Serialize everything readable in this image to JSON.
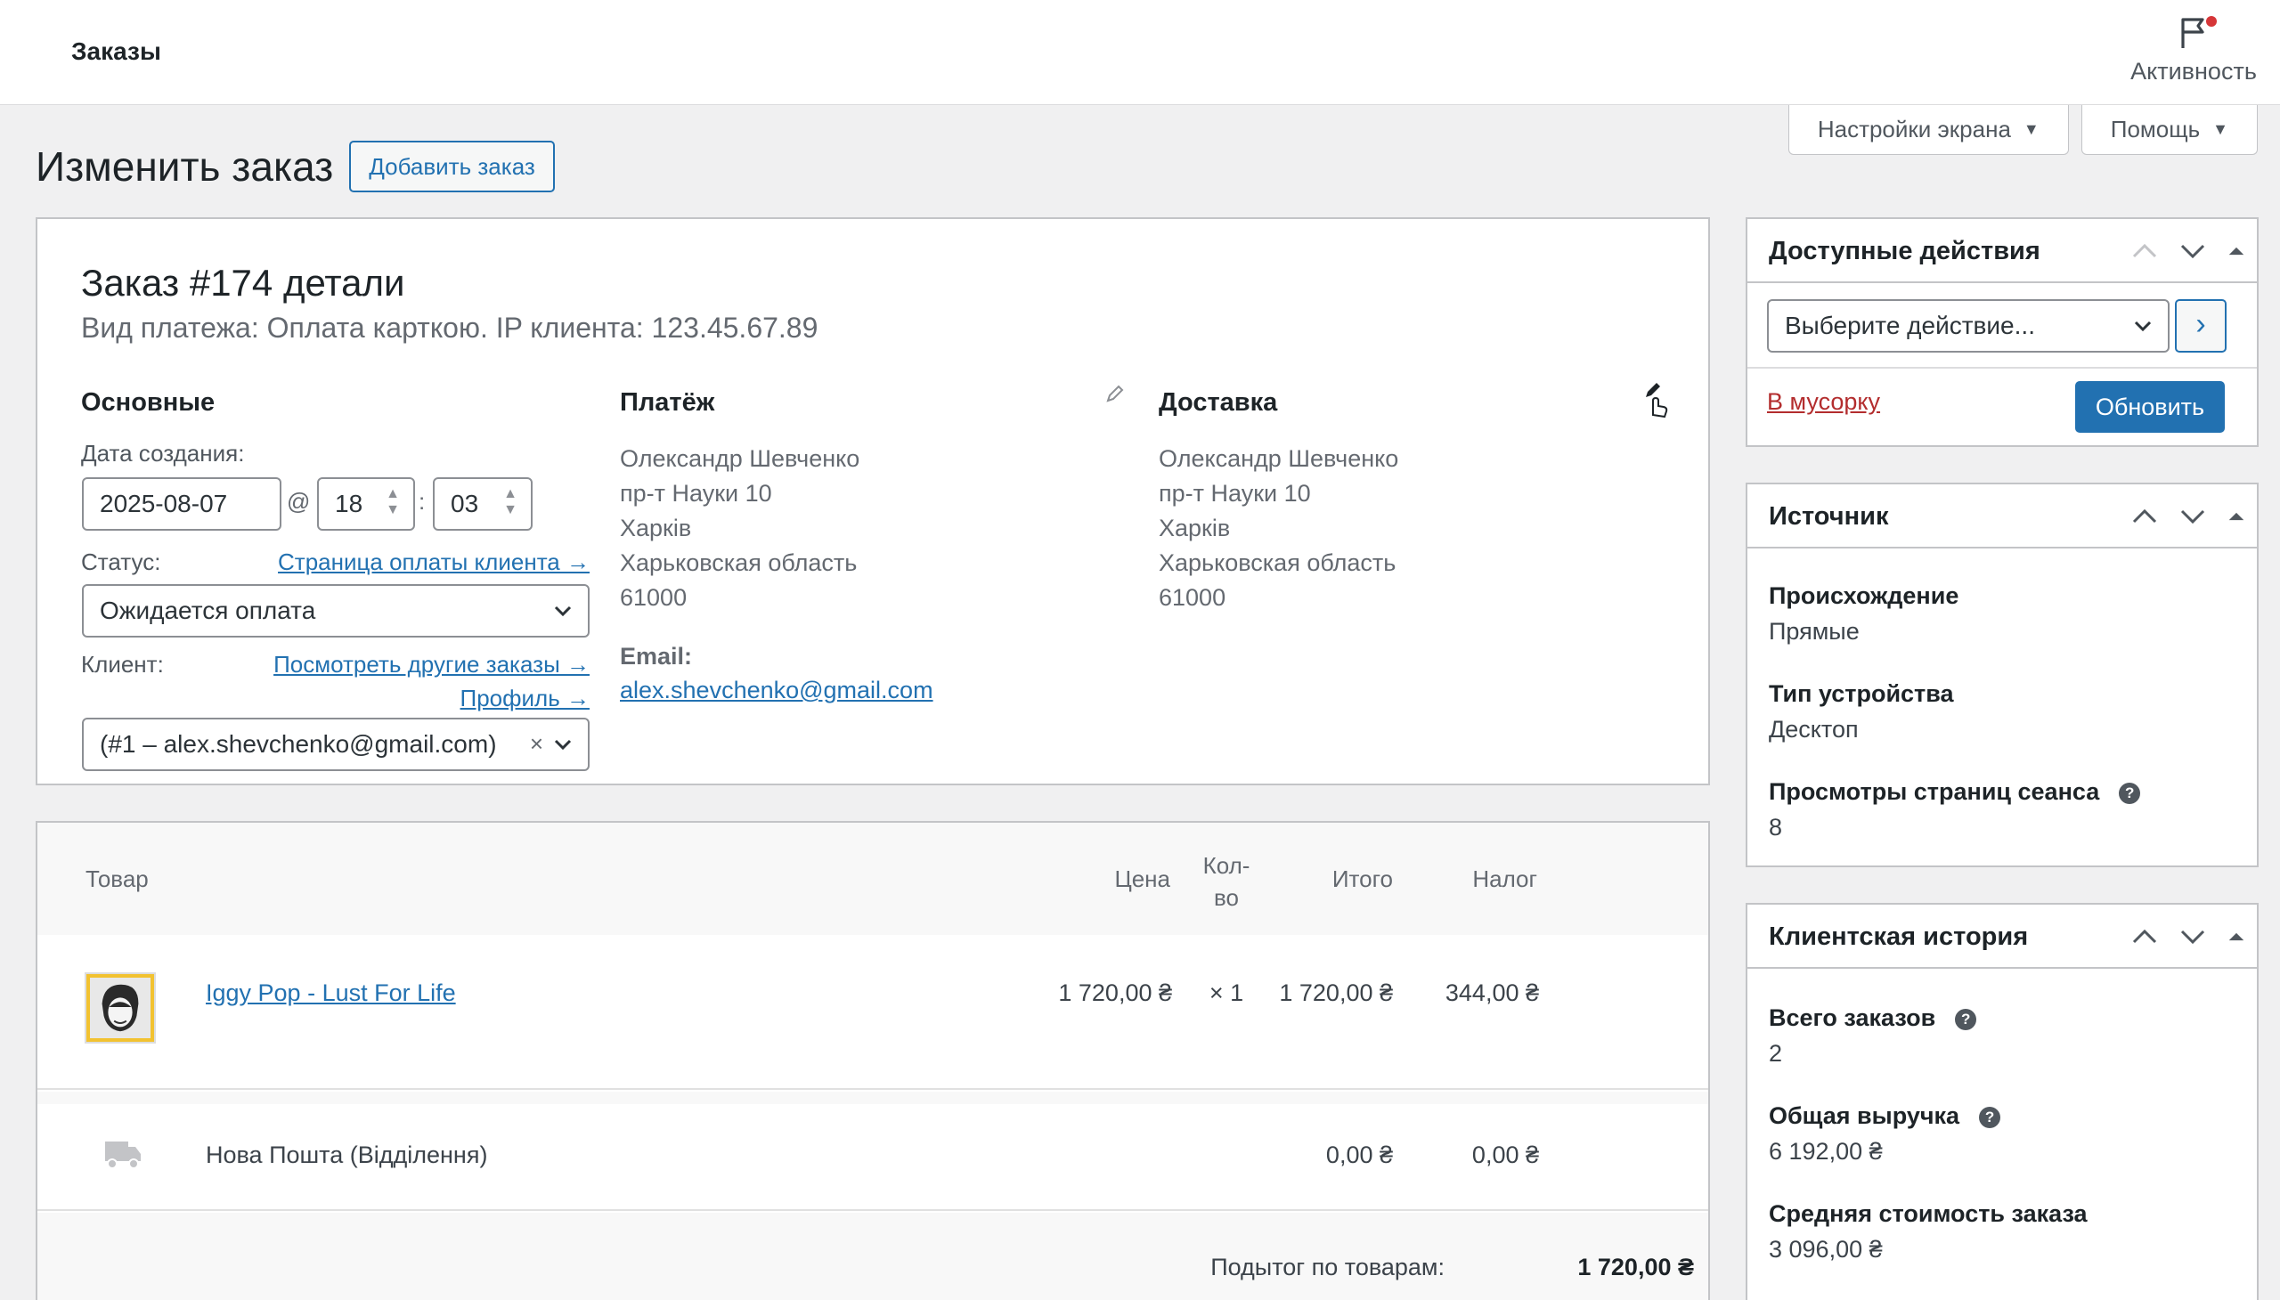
{
  "topbar": {
    "title": "Заказы",
    "activity_label": "Активность"
  },
  "screen_tabs": {
    "screen_options": "Настройки экрана",
    "help": "Помощь"
  },
  "page": {
    "heading": "Изменить заказ",
    "add_order": "Добавить заказ"
  },
  "order": {
    "title": "Заказ #174 детали",
    "subtitle": "Вид платежа: Оплата карткою. IP клиента: 123.45.67.89",
    "general": {
      "heading": "Основные",
      "date_label": "Дата создания:",
      "date": "2025-08-07",
      "at": "@",
      "hour": "18",
      "colon": ":",
      "minute": "03",
      "status_label": "Статус:",
      "payment_page_link": "Страница оплаты клиента →",
      "status_value": "Ожидается оплата",
      "customer_label": "Клиент:",
      "other_orders_link": "Посмотреть другие заказы →",
      "profile_link": "Профиль →",
      "customer_value": "(#1 – alex.shevchenko@gmail.com)",
      "clear": "×"
    },
    "billing": {
      "heading": "Платёж",
      "lines": [
        "Олександр Шевченко",
        "пр-т Науки 10",
        "Харків",
        "Харьковская область",
        "61000"
      ],
      "email_label": "Email:",
      "email": "alex.shevchenko@gmail.com"
    },
    "shipping": {
      "heading": "Доставка",
      "lines": [
        "Олександр Шевченко",
        "пр-т Науки 10",
        "Харків",
        "Харьковская область",
        "61000"
      ]
    }
  },
  "items": {
    "headers": {
      "product": "Товар",
      "price": "Цена",
      "qty_line1": "Кол-",
      "qty_line2": "во",
      "total": "Итого",
      "tax": "Налог"
    },
    "rows": [
      {
        "name": "Iggy Pop - Lust For Life",
        "price": "1 720,00 ₴",
        "qty": "× 1",
        "total": "1 720,00 ₴",
        "tax": "344,00 ₴"
      }
    ],
    "shipping": {
      "name": "Нова Пошта (Відділення)",
      "total": "0,00 ₴",
      "tax": "0,00 ₴"
    },
    "subtotal_label": "Подытог по товарам:",
    "subtotal_value": "1 720,00 ₴"
  },
  "actions_box": {
    "title": "Доступные действия",
    "select_placeholder": "Выберите действие...",
    "go": "›",
    "trash": "В мусорку",
    "update": "Обновить"
  },
  "source_box": {
    "title": "Источник",
    "origin_label": "Происхождение",
    "origin_value": "Прямые",
    "device_label": "Тип устройства",
    "device_value": "Десктоп",
    "pageviews_label": "Просмотры страниц сеанса",
    "pageviews_value": "8",
    "help": "?"
  },
  "history_box": {
    "title": "Клиентская история",
    "orders_label": "Всего заказов",
    "orders_value": "2",
    "revenue_label": "Общая выручка",
    "revenue_value": "6 192,00 ₴",
    "avg_label": "Средняя стоимость заказа",
    "avg_value": "3 096,00 ₴",
    "help": "?"
  },
  "colors": {
    "accent": "#2271b1",
    "danger": "#b32d2e",
    "notification": "#d63638"
  }
}
